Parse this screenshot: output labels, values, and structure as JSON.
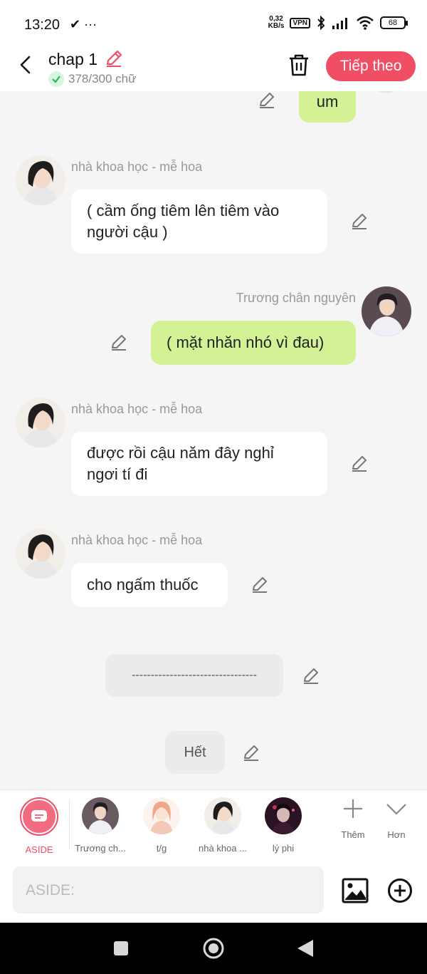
{
  "status": {
    "time": "13:20",
    "left_icons": "✔ ···",
    "net_speed_top": "0,32",
    "net_speed_bottom": "KB/s",
    "vpn": "VPN",
    "battery": "68"
  },
  "header": {
    "title": "chap 1",
    "word_count": "378/300 chữ",
    "next_label": "Tiếp theo"
  },
  "messages": [
    {
      "text": "um",
      "side": "right"
    },
    {
      "name": "nhà khoa học - mễ hoa",
      "text_lines": [
        "( cầm ống tiêm lên tiêm vào",
        "người cậu )"
      ],
      "side": "left"
    },
    {
      "name": "Trương chân nguyên",
      "text": "( mặt nhăn nhó vì đau)",
      "side": "right"
    },
    {
      "name": "nhà khoa học - mễ hoa",
      "text_lines": [
        "được rồi cậu năm đây nghỉ",
        "ngơi tí đi"
      ],
      "side": "left"
    },
    {
      "name": "nhà khoa học - mễ hoa",
      "text": "cho ngấm thuốc",
      "side": "left"
    },
    {
      "text": "---------------------------------",
      "side": "center"
    },
    {
      "text": "Hết",
      "side": "center"
    }
  ],
  "characters": [
    {
      "label": "ASIDE",
      "active": true
    },
    {
      "label": "Trương ch..."
    },
    {
      "label": "t/g"
    },
    {
      "label": "nhà khoa ..."
    },
    {
      "label": "lý phi"
    }
  ],
  "more": [
    {
      "label": "Thêm",
      "icon": "plus-icon"
    },
    {
      "label": "Hơn",
      "icon": "chevron-down-icon"
    }
  ],
  "input": {
    "placeholder": "ASIDE:"
  },
  "colors": {
    "accent": "#f04e64",
    "green_bubble": "#d4f295",
    "gray_bubble": "#ebebeb"
  }
}
